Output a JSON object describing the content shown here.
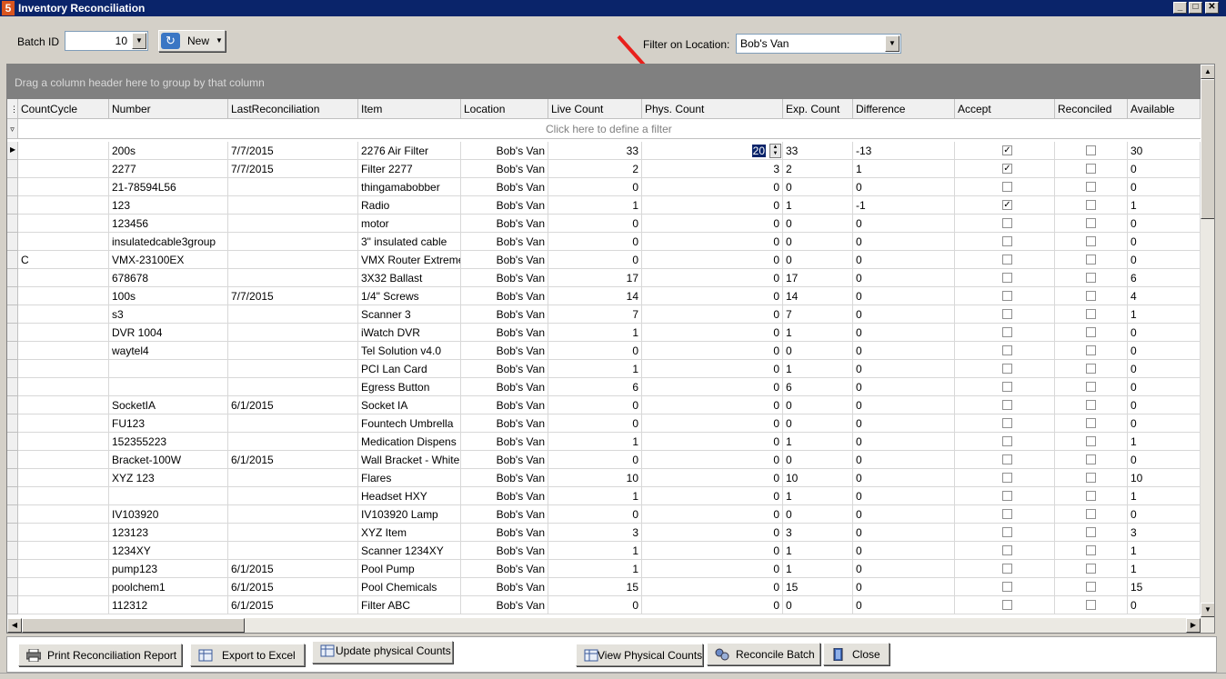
{
  "window": {
    "title": "Inventory Reconciliation",
    "min": "_",
    "max": "□",
    "close": "✕"
  },
  "toolbar": {
    "batch_label": "Batch ID",
    "batch_value": "10",
    "new_label": "New",
    "filter_label": "Filter on Location:",
    "filter_value": "Bob's Van"
  },
  "grid": {
    "group_hint": "Drag a column header here to group by that column",
    "filter_hint": "Click here to define a filter",
    "columns": [
      "CountCycle",
      "Number",
      "LastReconciliation",
      "Item",
      "Location",
      "Live Count",
      "Phys. Count",
      "Exp. Count",
      "Difference",
      "Accept",
      "Reconciled",
      "Available"
    ],
    "rows": [
      {
        "cc": "",
        "number": "200s",
        "last": "7/7/2015",
        "item": "2276 Air Filter",
        "loc": "Bob's Van",
        "live": "33",
        "phys": "20",
        "exp": "33",
        "diff": "-13",
        "accept": true,
        "rec": false,
        "avail": "30"
      },
      {
        "cc": "",
        "number": "2277",
        "last": "7/7/2015",
        "item": "Filter 2277",
        "loc": "Bob's Van",
        "live": "2",
        "phys": "3",
        "exp": "2",
        "diff": "1",
        "accept": true,
        "rec": false,
        "avail": "0"
      },
      {
        "cc": "",
        "number": "21-78594L56",
        "last": "",
        "item": "thingamabobber",
        "loc": "Bob's Van",
        "live": "0",
        "phys": "0",
        "exp": "0",
        "diff": "0",
        "accept": false,
        "rec": false,
        "avail": "0"
      },
      {
        "cc": "",
        "number": "123",
        "last": "",
        "item": "Radio",
        "loc": "Bob's Van",
        "live": "1",
        "phys": "0",
        "exp": "1",
        "diff": "-1",
        "accept": true,
        "rec": false,
        "avail": "1"
      },
      {
        "cc": "",
        "number": "123456",
        "last": "",
        "item": "motor",
        "loc": "Bob's Van",
        "live": "0",
        "phys": "0",
        "exp": "0",
        "diff": "0",
        "accept": false,
        "rec": false,
        "avail": "0"
      },
      {
        "cc": "",
        "number": "insulatedcable3group",
        "last": "",
        "item": "3\" insulated cable",
        "loc": "Bob's Van",
        "live": "0",
        "phys": "0",
        "exp": "0",
        "diff": "0",
        "accept": false,
        "rec": false,
        "avail": "0"
      },
      {
        "cc": "C",
        "number": "VMX-23100EX",
        "last": "",
        "item": "VMX Router Extreme",
        "loc": "Bob's Van",
        "live": "0",
        "phys": "0",
        "exp": "0",
        "diff": "0",
        "accept": false,
        "rec": false,
        "avail": "0"
      },
      {
        "cc": "",
        "number": "678678",
        "last": "",
        "item": "3X32 Ballast",
        "loc": "Bob's Van",
        "live": "17",
        "phys": "0",
        "exp": "17",
        "diff": "0",
        "accept": false,
        "rec": false,
        "avail": "6"
      },
      {
        "cc": "",
        "number": "100s",
        "last": "7/7/2015",
        "item": "1/4\" Screws",
        "loc": "Bob's Van",
        "live": "14",
        "phys": "0",
        "exp": "14",
        "diff": "0",
        "accept": false,
        "rec": false,
        "avail": "4"
      },
      {
        "cc": "",
        "number": "s3",
        "last": "",
        "item": "Scanner 3",
        "loc": "Bob's Van",
        "live": "7",
        "phys": "0",
        "exp": "7",
        "diff": "0",
        "accept": false,
        "rec": false,
        "avail": "1"
      },
      {
        "cc": "",
        "number": "DVR 1004",
        "last": "",
        "item": "iWatch DVR",
        "loc": "Bob's Van",
        "live": "1",
        "phys": "0",
        "exp": "1",
        "diff": "0",
        "accept": false,
        "rec": false,
        "avail": "0"
      },
      {
        "cc": "",
        "number": "waytel4",
        "last": "",
        "item": "Tel  Solution v4.0",
        "loc": "Bob's Van",
        "live": "0",
        "phys": "0",
        "exp": "0",
        "diff": "0",
        "accept": false,
        "rec": false,
        "avail": "0"
      },
      {
        "cc": "",
        "number": "",
        "last": "",
        "item": "PCI Lan Card",
        "loc": "Bob's Van",
        "live": "1",
        "phys": "0",
        "exp": "1",
        "diff": "0",
        "accept": false,
        "rec": false,
        "avail": "0"
      },
      {
        "cc": "",
        "number": "",
        "last": "",
        "item": "Egress Button",
        "loc": "Bob's Van",
        "live": "6",
        "phys": "0",
        "exp": "6",
        "diff": "0",
        "accept": false,
        "rec": false,
        "avail": "0"
      },
      {
        "cc": "",
        "number": "SocketIA",
        "last": "6/1/2015",
        "item": "Socket IA",
        "loc": "Bob's Van",
        "live": "0",
        "phys": "0",
        "exp": "0",
        "diff": "0",
        "accept": false,
        "rec": false,
        "avail": "0"
      },
      {
        "cc": "",
        "number": "FU123",
        "last": "",
        "item": "Fountech Umbrella",
        "loc": "Bob's Van",
        "live": "0",
        "phys": "0",
        "exp": "0",
        "diff": "0",
        "accept": false,
        "rec": false,
        "avail": "0"
      },
      {
        "cc": "",
        "number": "152355223",
        "last": "",
        "item": "Medication Dispens",
        "loc": "Bob's Van",
        "live": "1",
        "phys": "0",
        "exp": "1",
        "diff": "0",
        "accept": false,
        "rec": false,
        "avail": "1"
      },
      {
        "cc": "",
        "number": "Bracket-100W",
        "last": "6/1/2015",
        "item": "Wall Bracket - White",
        "loc": "Bob's Van",
        "live": "0",
        "phys": "0",
        "exp": "0",
        "diff": "0",
        "accept": false,
        "rec": false,
        "avail": "0"
      },
      {
        "cc": "",
        "number": "XYZ 123",
        "last": "",
        "item": "Flares",
        "loc": "Bob's Van",
        "live": "10",
        "phys": "0",
        "exp": "10",
        "diff": "0",
        "accept": false,
        "rec": false,
        "avail": "10"
      },
      {
        "cc": "",
        "number": "",
        "last": "",
        "item": "Headset HXY",
        "loc": "Bob's Van",
        "live": "1",
        "phys": "0",
        "exp": "1",
        "diff": "0",
        "accept": false,
        "rec": false,
        "avail": "1"
      },
      {
        "cc": "",
        "number": "IV103920",
        "last": "",
        "item": "IV103920 Lamp",
        "loc": "Bob's Van",
        "live": "0",
        "phys": "0",
        "exp": "0",
        "diff": "0",
        "accept": false,
        "rec": false,
        "avail": "0"
      },
      {
        "cc": "",
        "number": "123123",
        "last": "",
        "item": "XYZ Item",
        "loc": "Bob's Van",
        "live": "3",
        "phys": "0",
        "exp": "3",
        "diff": "0",
        "accept": false,
        "rec": false,
        "avail": "3"
      },
      {
        "cc": "",
        "number": "1234XY",
        "last": "",
        "item": "Scanner 1234XY",
        "loc": "Bob's Van",
        "live": "1",
        "phys": "0",
        "exp": "1",
        "diff": "0",
        "accept": false,
        "rec": false,
        "avail": "1"
      },
      {
        "cc": "",
        "number": "pump123",
        "last": "6/1/2015",
        "item": "Pool Pump",
        "loc": "Bob's Van",
        "live": "1",
        "phys": "0",
        "exp": "1",
        "diff": "0",
        "accept": false,
        "rec": false,
        "avail": "1"
      },
      {
        "cc": "",
        "number": "poolchem1",
        "last": "6/1/2015",
        "item": "Pool Chemicals",
        "loc": "Bob's Van",
        "live": "15",
        "phys": "0",
        "exp": "15",
        "diff": "0",
        "accept": false,
        "rec": false,
        "avail": "15"
      },
      {
        "cc": "",
        "number": "112312",
        "last": "6/1/2015",
        "item": "Filter ABC",
        "loc": "Bob's Van",
        "live": "0",
        "phys": "0",
        "exp": "0",
        "diff": "0",
        "accept": false,
        "rec": false,
        "avail": "0"
      }
    ]
  },
  "buttons": {
    "print": "Print Reconciliation Report",
    "export": "Export to Excel",
    "update": "Update physical Counts",
    "view": "View Physical Counts",
    "reconcile": "Reconcile Batch",
    "close": "Close"
  },
  "colors": {
    "titlebar": "#0a246a",
    "annotation_arrow": "#e8201c",
    "group_bar": "#808080"
  }
}
